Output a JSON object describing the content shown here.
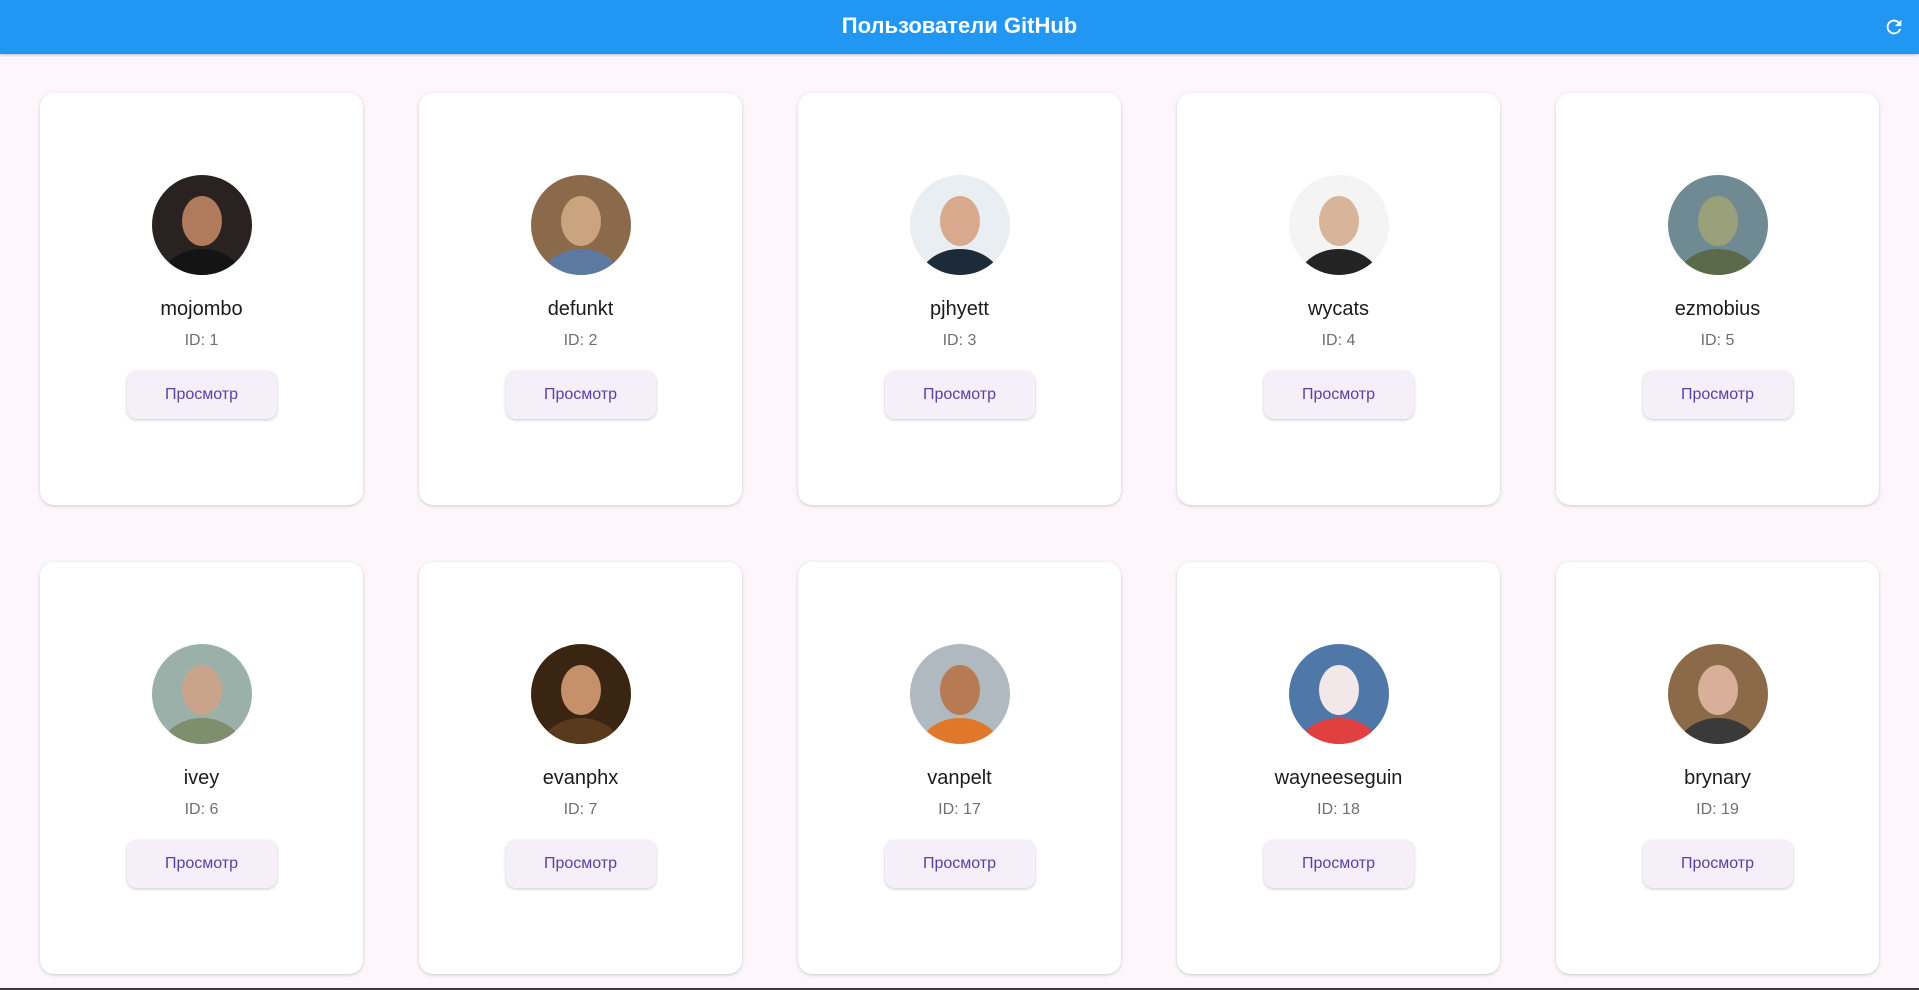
{
  "appbar": {
    "title": "Пользователи GitHub",
    "refresh_icon": "refresh-icon",
    "color": "#2196f3"
  },
  "view_label": "Просмотр",
  "users": [
    {
      "login": "mojombo",
      "id_text": "ID: 1",
      "avatar_colors": [
        "#2a2220",
        "#b07a5c",
        "#141414"
      ]
    },
    {
      "login": "defunkt",
      "id_text": "ID: 2",
      "avatar_colors": [
        "#8a6a4a",
        "#caa47e",
        "#5c7aa0"
      ]
    },
    {
      "login": "pjhyett",
      "id_text": "ID: 3",
      "avatar_colors": [
        "#e8eef2",
        "#d9a98e",
        "#1d2a38"
      ]
    },
    {
      "login": "wycats",
      "id_text": "ID: 4",
      "avatar_colors": [
        "#f4f4f4",
        "#d8b49a",
        "#232323"
      ]
    },
    {
      "login": "ezmobius",
      "id_text": "ID: 5",
      "avatar_colors": [
        "#6f8a92",
        "#9aa07a",
        "#5a6a4a"
      ]
    },
    {
      "login": "ivey",
      "id_text": "ID: 6",
      "avatar_colors": [
        "#9ab0a8",
        "#c9a48a",
        "#7e8f6e"
      ]
    },
    {
      "login": "evanphx",
      "id_text": "ID: 7",
      "avatar_colors": [
        "#3a2412",
        "#c6906a",
        "#5a3a1c"
      ]
    },
    {
      "login": "vanpelt",
      "id_text": "ID: 17",
      "avatar_colors": [
        "#b0b8c0",
        "#b87a52",
        "#e0782a"
      ]
    },
    {
      "login": "wayneeseguin",
      "id_text": "ID: 18",
      "avatar_colors": [
        "#4f78a8",
        "#f2e8ea",
        "#e04040"
      ]
    },
    {
      "login": "brynary",
      "id_text": "ID: 19",
      "avatar_colors": [
        "#8a6a48",
        "#d8b09a",
        "#3a3a3a"
      ]
    }
  ]
}
